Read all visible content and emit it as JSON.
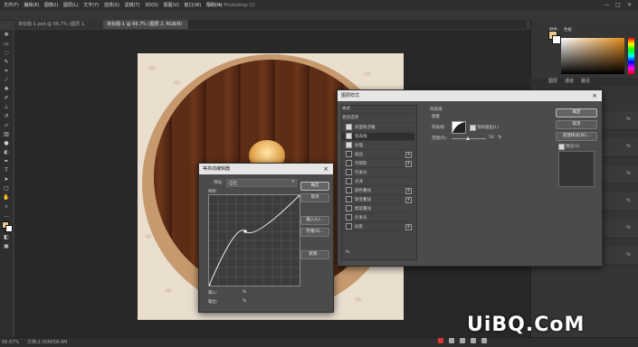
{
  "menubar": {
    "items": [
      "文件(F)",
      "编辑(E)",
      "图像(I)",
      "图层(L)",
      "文字(Y)",
      "选择(S)",
      "滤镜(T)",
      "3D(D)",
      "视图(V)",
      "窗口(W)",
      "帮助(H)"
    ],
    "center_title": "Adobe Photoshop CC",
    "minimize": "—",
    "maximize": "□",
    "close": "✕"
  },
  "tabs": [
    {
      "label": "未标题-1.psd @ 66.7% (图层 1, RGB/8) ×",
      "active": false
    },
    {
      "label": "未标题-1 @ 66.7% (图层 2, RGB/8) ×",
      "active": true
    }
  ],
  "statusbar": {
    "zoom": "66.67%",
    "doc": "文档:2.00M/58.4M"
  },
  "panels": {
    "color_tab": "颜色",
    "swatch_tab": "色板",
    "lower_tabs": [
      "图层",
      "通道",
      "路径"
    ],
    "fx_label": "fx"
  },
  "layer_style_dialog": {
    "title": "图层样式",
    "sidebar_header": "样式",
    "blend_options": "混合选项",
    "rows": [
      {
        "label": "斜面和浮雕",
        "checked": true,
        "plus": false,
        "selected": false
      },
      {
        "label": "等高线",
        "checked": true,
        "plus": false,
        "selected": true
      },
      {
        "label": "纹理",
        "checked": true,
        "plus": false,
        "selected": false
      },
      {
        "label": "描边",
        "checked": false,
        "plus": true,
        "selected": false
      },
      {
        "label": "内阴影",
        "checked": false,
        "plus": true,
        "selected": false
      },
      {
        "label": "内发光",
        "checked": false,
        "plus": false,
        "selected": false
      },
      {
        "label": "光泽",
        "checked": false,
        "plus": false,
        "selected": false
      },
      {
        "label": "颜色叠加",
        "checked": false,
        "plus": true,
        "selected": false
      },
      {
        "label": "渐变叠加",
        "checked": false,
        "plus": true,
        "selected": false
      },
      {
        "label": "图案叠加",
        "checked": false,
        "plus": false,
        "selected": false
      },
      {
        "label": "外发光",
        "checked": false,
        "plus": false,
        "selected": false
      },
      {
        "label": "投影",
        "checked": false,
        "plus": true,
        "selected": false
      }
    ],
    "section_title": "等高线",
    "group_title": "图素",
    "contour_label": "等高线:",
    "antialias_label": "消除锯齿(L)",
    "range_label": "范围(R):",
    "range_value": "50",
    "range_unit": "%",
    "ok": "确定",
    "cancel": "取消",
    "new_style": "新建样式(W)...",
    "preview": "预览(V)",
    "preview_checked": true,
    "footer_fx": "fx"
  },
  "contour_editor": {
    "title": "等高线编辑器",
    "preset_label": "预设:",
    "preset_value": "自定",
    "mapping_label": "映射",
    "ok": "确定",
    "cancel": "取消",
    "load": "载入(L)...",
    "save": "存储(S)...",
    "new": "新建...",
    "input_label": "输入:",
    "output_label": "输出:",
    "percent": "%",
    "curve_points": [
      [
        0,
        0
      ],
      [
        40,
        60
      ],
      [
        100,
        100
      ]
    ]
  },
  "watermark": "UiBQ.CoM"
}
